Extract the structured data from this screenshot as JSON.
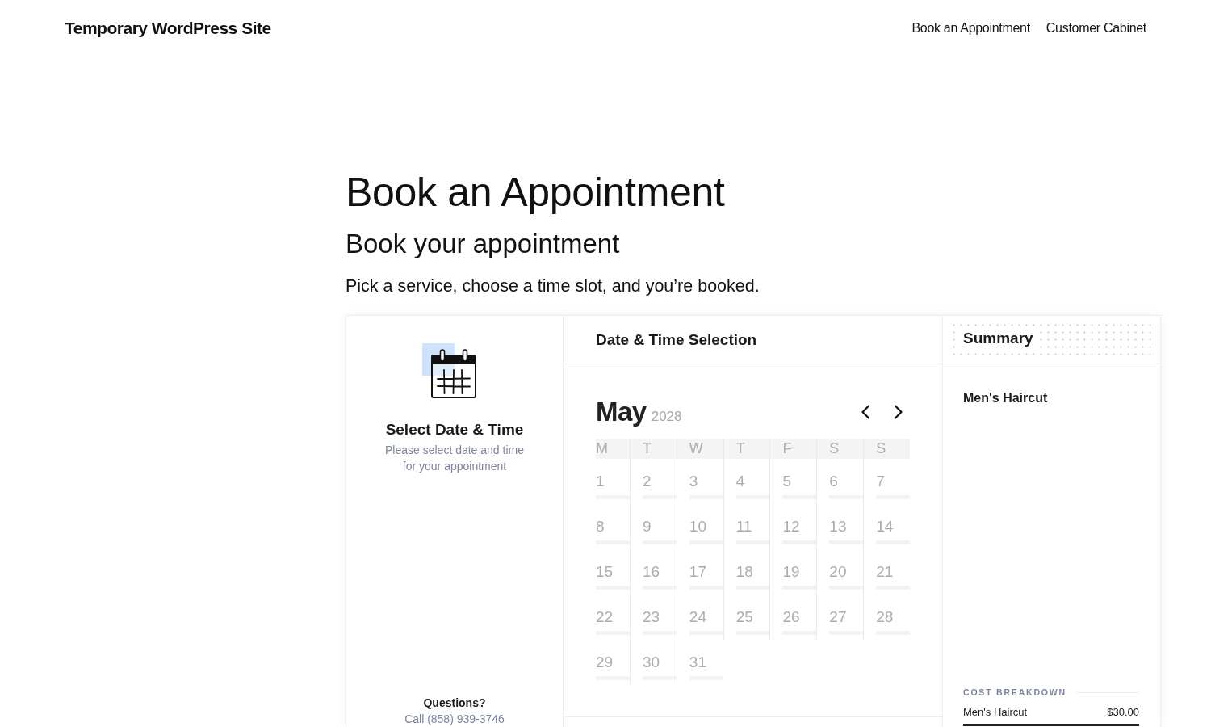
{
  "site": {
    "title": "Temporary WordPress Site",
    "nav": [
      {
        "label": "Book an Appointment"
      },
      {
        "label": "Customer Cabinet"
      }
    ]
  },
  "page": {
    "title": "Book an Appointment",
    "subtitle": "Book your appointment",
    "intro": "Pick a service, choose a time slot, and you’re booked."
  },
  "booking": {
    "step": {
      "title": "Select Date & Time",
      "description": "Please select date and time for your appointment",
      "help_title": "Questions?",
      "help_contact": "Call (858) 939-3746"
    },
    "panel_title": "Date & Time Selection",
    "calendar": {
      "month": "May",
      "year": "2028",
      "weekdays": [
        "M",
        "T",
        "W",
        "T",
        "F",
        "S",
        "S"
      ],
      "days": [
        {
          "label": "1",
          "disabled": true
        },
        {
          "label": "2",
          "disabled": true
        },
        {
          "label": "3",
          "disabled": true
        },
        {
          "label": "4",
          "disabled": true
        },
        {
          "label": "5",
          "disabled": true
        },
        {
          "label": "6",
          "disabled": true
        },
        {
          "label": "7",
          "disabled": true
        },
        {
          "label": "8",
          "disabled": true
        },
        {
          "label": "9",
          "disabled": true
        },
        {
          "label": "10",
          "disabled": true
        },
        {
          "label": "11",
          "disabled": true
        },
        {
          "label": "12",
          "disabled": true
        },
        {
          "label": "13",
          "disabled": true
        },
        {
          "label": "14",
          "disabled": true
        },
        {
          "label": "15",
          "disabled": true
        },
        {
          "label": "16",
          "disabled": true
        },
        {
          "label": "17",
          "disabled": true
        },
        {
          "label": "18",
          "disabled": true
        },
        {
          "label": "19",
          "disabled": true
        },
        {
          "label": "20",
          "disabled": true
        },
        {
          "label": "21",
          "disabled": true
        },
        {
          "label": "22",
          "disabled": true
        },
        {
          "label": "23",
          "disabled": true
        },
        {
          "label": "24",
          "disabled": true
        },
        {
          "label": "25",
          "disabled": true
        },
        {
          "label": "26",
          "disabled": true
        },
        {
          "label": "27",
          "disabled": true
        },
        {
          "label": "28",
          "disabled": true
        },
        {
          "label": "29",
          "disabled": true
        },
        {
          "label": "30",
          "disabled": true
        },
        {
          "label": "31",
          "disabled": true
        }
      ]
    },
    "summary": {
      "title": "Summary",
      "service": "Men's Haircut",
      "cost_heading": "COST BREAKDOWN",
      "items": [
        {
          "name": "Men's Haircut",
          "price": "$30.00"
        }
      ]
    }
  }
}
